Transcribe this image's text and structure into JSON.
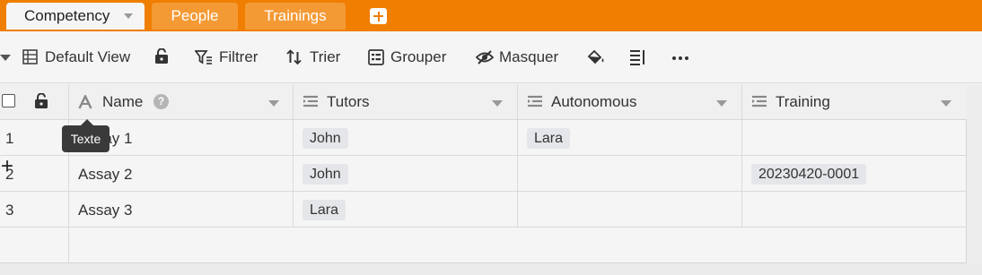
{
  "tabs": [
    {
      "label": "Competency",
      "active": true
    },
    {
      "label": "People",
      "active": false
    },
    {
      "label": "Trainings",
      "active": false
    }
  ],
  "toolbar": {
    "view_label": "Default View",
    "filter_label": "Filtrer",
    "sort_label": "Trier",
    "group_label": "Grouper",
    "hide_label": "Masquer"
  },
  "columns": {
    "name": "Name",
    "tutors": "Tutors",
    "autonomous": "Autonomous",
    "training": "Training"
  },
  "rows": [
    {
      "num": "1",
      "name": "Assay 1",
      "tutors": "John",
      "autonomous": "Lara",
      "training": ""
    },
    {
      "num": "2",
      "name": "Assay 2",
      "tutors": "John",
      "autonomous": "",
      "training": "20230420-0001"
    },
    {
      "num": "3",
      "name": "Assay 3",
      "tutors": "Lara",
      "autonomous": "",
      "training": ""
    }
  ],
  "tooltip": "Texte",
  "add_row_symbol": "+",
  "colors": {
    "accent": "#f07e00",
    "tag_bg": "#e4e6ea"
  }
}
